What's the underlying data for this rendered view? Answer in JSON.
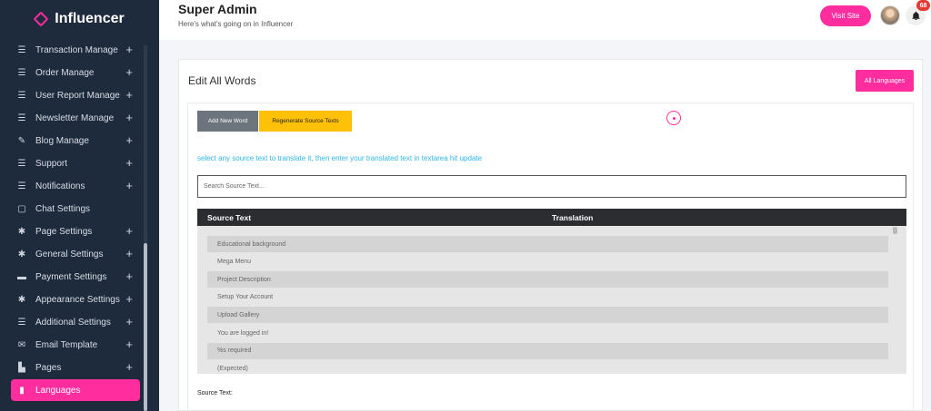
{
  "brand": {
    "name": "Influencer",
    "accent": "#ff2d9e"
  },
  "sidebar": {
    "items": [
      {
        "label": "Transaction Manage",
        "icon": "list-icon",
        "has_plus": true
      },
      {
        "label": "Order Manage",
        "icon": "list-icon",
        "has_plus": true
      },
      {
        "label": "User Report Manage",
        "icon": "list-icon",
        "has_plus": true
      },
      {
        "label": "Newsletter Manage",
        "icon": "list-icon",
        "has_plus": true
      },
      {
        "label": "Blog Manage",
        "icon": "blog-icon",
        "has_plus": true
      },
      {
        "label": "Support",
        "icon": "list-icon",
        "has_plus": true
      },
      {
        "label": "Notifications",
        "icon": "list-icon",
        "has_plus": true
      },
      {
        "label": "Chat Settings",
        "icon": "chat-icon",
        "has_plus": false
      },
      {
        "label": "Page Settings",
        "icon": "gear-icon",
        "has_plus": true
      },
      {
        "label": "General Settings",
        "icon": "gear-icon",
        "has_plus": true
      },
      {
        "label": "Payment Settings",
        "icon": "briefcase-icon",
        "has_plus": true
      },
      {
        "label": "Appearance Settings",
        "icon": "gear-icon",
        "has_plus": true
      },
      {
        "label": "Additional Settings",
        "icon": "list-icon",
        "has_plus": true
      },
      {
        "label": "Email Template",
        "icon": "envelope-icon",
        "has_plus": true
      },
      {
        "label": "Pages",
        "icon": "pages-icon",
        "has_plus": true
      },
      {
        "label": "Languages",
        "icon": "bar-chart-icon",
        "has_plus": false,
        "active": true
      }
    ]
  },
  "header": {
    "title": "Super Admin",
    "subtitle": "Here's what's going on in Influencer",
    "visit_site_label": "Visit Site",
    "notification_count": "68"
  },
  "main": {
    "card_title": "Edit All Words",
    "all_languages_label": "All Languages",
    "add_new_word_label": "Add New Word",
    "regenerate_label": "Regenerate Source Texts",
    "hint": "select any source text to translate it, then enter your translated text in textarea hit update",
    "search_placeholder": "Search Source Text...",
    "columns": [
      "Source Text",
      "Translation"
    ],
    "rows": [
      "Educational background",
      "Mega Menu",
      "Project Description",
      "Setup Your Account",
      "Upload Gallery",
      "You are logged in!",
      "%s required",
      "(Expected)"
    ],
    "source_text_label": "Source Text:"
  }
}
